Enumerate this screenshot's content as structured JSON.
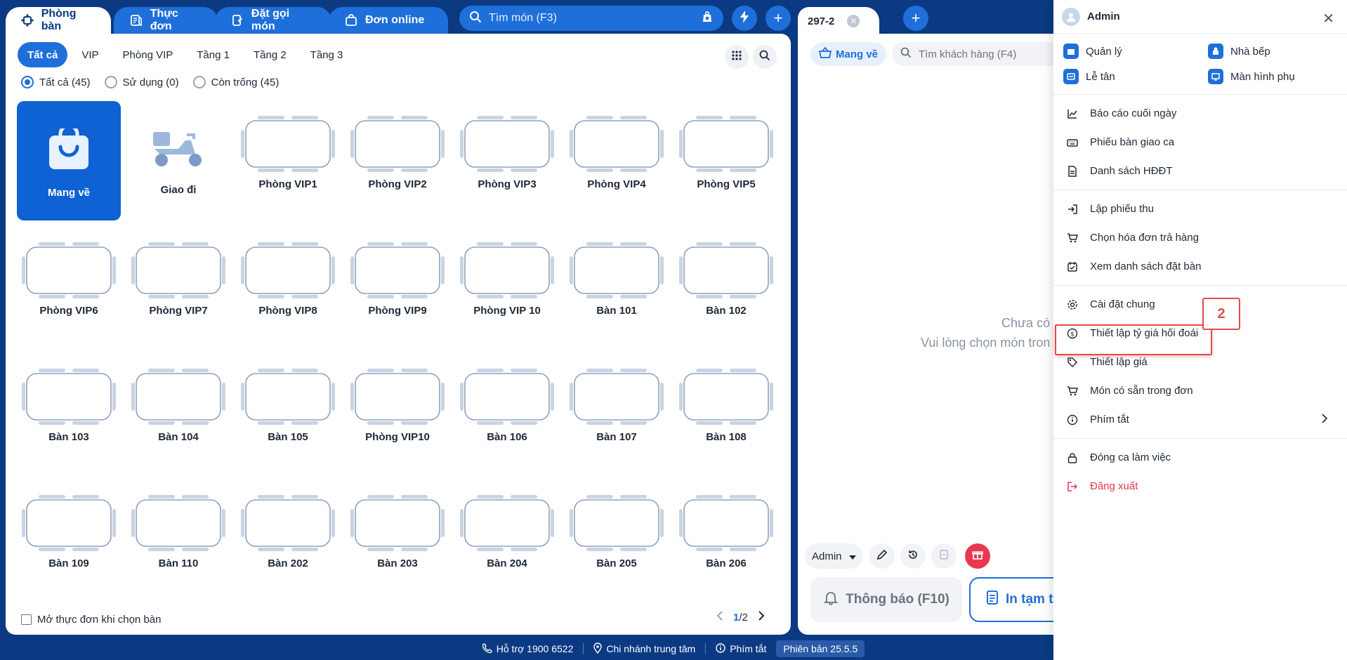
{
  "tabs": [
    {
      "label": "Phòng bàn",
      "icon": "table-icon"
    },
    {
      "label": "Thực đơn",
      "icon": "menu-book-icon"
    },
    {
      "label": "Đặt gọi món",
      "icon": "order-icon"
    },
    {
      "label": "Đơn online",
      "icon": "bag-icon"
    }
  ],
  "search": {
    "placeholder": "Tìm món (F3)"
  },
  "filters": [
    "Tất cả",
    "VIP",
    "Phòng VIP",
    "Tầng 1",
    "Tầng 2",
    "Tầng 3"
  ],
  "status_filters": [
    "Tất cả (45)",
    "Sử dụng (0)",
    "Còn trống (45)"
  ],
  "tables": [
    "Mang về",
    "Giao đi",
    "Phòng VIP1",
    "Phòng VIP2",
    "Phòng VIP3",
    "Phòng VIP4",
    "Phòng VIP5",
    "Phòng VIP6",
    "Phòng VIP7",
    "Phòng VIP8",
    "Phòng VIP9",
    "Phòng VIP 10",
    "Bàn 101",
    "Bàn 102",
    "Bàn 103",
    "Bàn 104",
    "Bàn 105",
    "Phòng VIP10",
    "Bàn 106",
    "Bàn 107",
    "Bàn 108",
    "Bàn 109",
    "Bàn 110",
    "Bàn 202",
    "Bàn 203",
    "Bàn 204",
    "Bàn 205",
    "Bàn 206"
  ],
  "footer": {
    "open_menu_label": "Mở thực đơn khi chọn bàn",
    "page_current": "1",
    "page_total": "/2"
  },
  "order": {
    "tab_label": "297-2",
    "mode_label": "Mang về",
    "customer_placeholder": "Tìm khách hàng (F4)",
    "empty_line1": "Chưa có",
    "empty_line2": "Vui lòng chọn món tron",
    "staff": "Admin",
    "notify_label": "Thông báo (F10)",
    "print_label": "In tạm tí"
  },
  "statusbar": {
    "support": "Hỗ trợ 1900 6522",
    "branch": "Chi nhánh trung tâm",
    "shortcuts": "Phím tắt",
    "version": "Phiên bản 25.5.5"
  },
  "menu": {
    "user": "Admin",
    "quick": [
      "Quản lý",
      "Nhà bếp",
      "Lễ tân",
      "Màn hình phụ"
    ],
    "group1": [
      "Báo cáo cuối ngày",
      "Phiếu bàn giao ca",
      "Danh sách HĐĐT"
    ],
    "group2": [
      "Lập phiếu thu",
      "Chọn hóa đơn trả hàng",
      "Xem danh sách đặt bàn"
    ],
    "group3": [
      "Cài đặt chung",
      "Thiết lập tỷ giá hối đoái",
      "Thiết lập giá",
      "Món có sẵn trong đơn",
      "Phím tắt"
    ],
    "group4": [
      "Đóng ca làm việc",
      "Đăng xuất"
    ]
  },
  "annotation": {
    "step": "2"
  },
  "colors": {
    "brand": "#0b3a83",
    "accent": "#1e6fd9",
    "danger": "#e8384f"
  }
}
